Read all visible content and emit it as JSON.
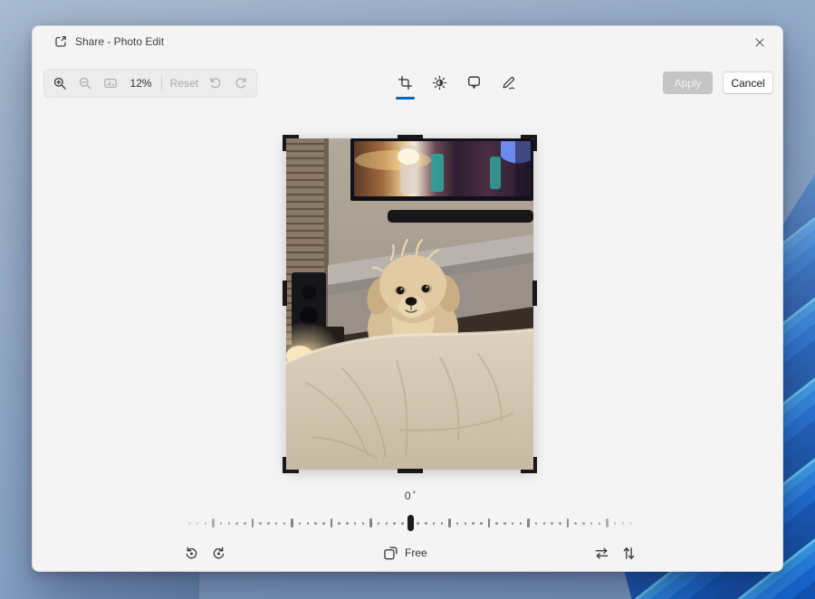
{
  "window": {
    "title": "Share - Photo Edit"
  },
  "toolbar": {
    "zoom_percent": "12%",
    "reset": "Reset",
    "apply": "Apply",
    "cancel": "Cancel"
  },
  "edit_tools": {
    "active": "crop",
    "icons": [
      "crop-icon",
      "adjust-icon",
      "filter-icon",
      "markup-icon"
    ]
  },
  "rotation": {
    "value": "0",
    "unit": "°"
  },
  "bottom_bar": {
    "aspect_label": "Free",
    "icons": [
      "rotate-left-icon",
      "rotate-right-icon",
      "aspect-ratio-icon",
      "flip-horizontal-icon",
      "flip-vertical-icon"
    ]
  },
  "colors": {
    "accent": "#0067c0",
    "apply_disabled_bg": "#c5c5c5",
    "window_bg": "#f4f4f4"
  },
  "photo": {
    "alt": "Cream shih tzu dog sitting behind a beige blanket in a living room with a wall-mounted TV, soundbar, mantel, blinds, speaker and lamp"
  }
}
